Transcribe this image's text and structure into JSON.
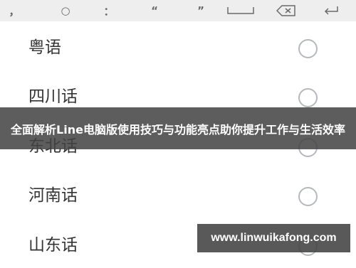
{
  "keyboard": {
    "keys": [
      {
        "label": "，",
        "icon": "comma-key"
      },
      {
        "label": "○",
        "icon": "circle-key"
      },
      {
        "label": "：",
        "icon": "colon-key"
      },
      {
        "label": "“",
        "icon": "open-quote-key"
      },
      {
        "label": "”",
        "icon": "close-quote-key"
      },
      {
        "label": "",
        "icon": "space-key-icon"
      },
      {
        "label": "",
        "icon": "backspace-icon"
      },
      {
        "label": "",
        "icon": "enter-icon"
      }
    ]
  },
  "dialect_options": [
    {
      "label": "粤语",
      "selected": false
    },
    {
      "label": "四川话",
      "selected": false
    },
    {
      "label": "东北话",
      "selected": false
    },
    {
      "label": "河南话",
      "selected": false
    },
    {
      "label": "山东话",
      "selected": false
    }
  ],
  "banner": {
    "text": "全面解析Line电脑版使用技巧与功能亮点助你提升工作与生活效率"
  },
  "watermark": {
    "text": "www.linwuikafong.com"
  }
}
